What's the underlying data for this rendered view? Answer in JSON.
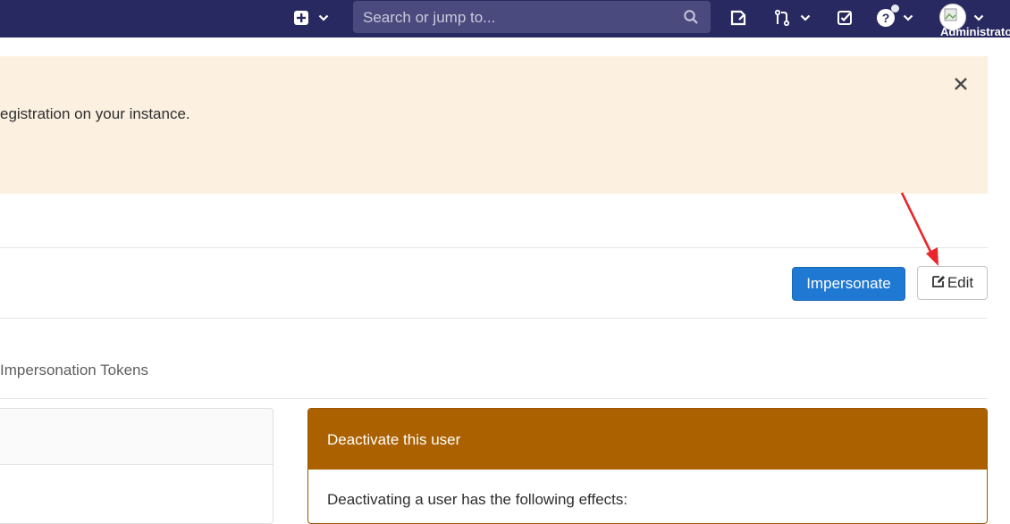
{
  "navbar": {
    "search_placeholder": "Search or jump to...",
    "user_label": "Administrator",
    "icons": [
      "plus-square-icon",
      "chevron-down-icon",
      "search-icon",
      "issues-icon",
      "merge-request-icon",
      "todo-icon",
      "help-icon",
      "avatar"
    ]
  },
  "banner": {
    "text": "egistration on your instance."
  },
  "actions": {
    "impersonate_label": "Impersonate",
    "edit_label": "Edit"
  },
  "tabs": {
    "impersonation_tokens": "Impersonation Tokens"
  },
  "deactivate_card": {
    "title": "Deactivate this user",
    "body": "Deactivating a user has the following effects:"
  },
  "colors": {
    "navbar_bg": "#292961",
    "banner_bg": "#fcf0e1",
    "primary": "#1f78d1",
    "warning_header": "#ab6100",
    "annotation_arrow": "#e8262b"
  }
}
